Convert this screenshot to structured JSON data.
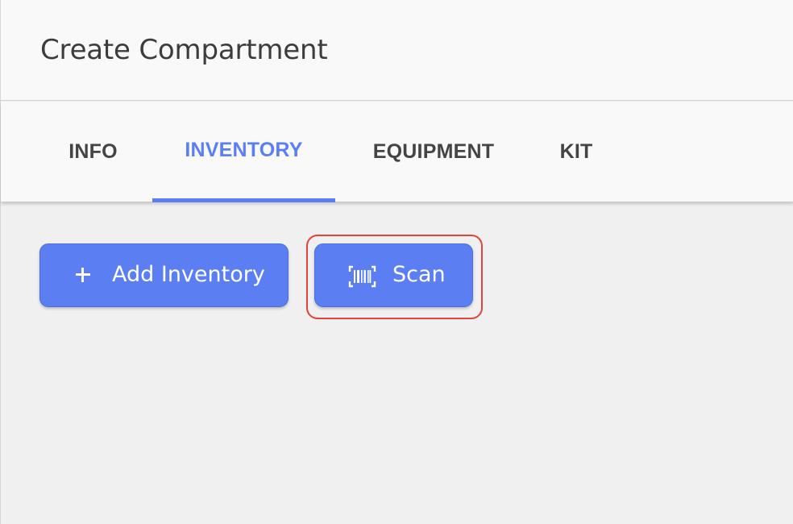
{
  "header": {
    "title": "Create Compartment"
  },
  "tabs": [
    {
      "label": "INFO",
      "active": false
    },
    {
      "label": "INVENTORY",
      "active": true
    },
    {
      "label": "EQUIPMENT",
      "active": false
    },
    {
      "label": "KIT",
      "active": false
    }
  ],
  "actions": {
    "add_inventory": {
      "label": "Add Inventory",
      "icon": "plus-icon"
    },
    "scan": {
      "label": "Scan",
      "icon": "barcode-scan-icon"
    }
  },
  "colors": {
    "accent": "#5b7ff2",
    "highlight": "#e0443a",
    "background": "#f0f0f0"
  }
}
